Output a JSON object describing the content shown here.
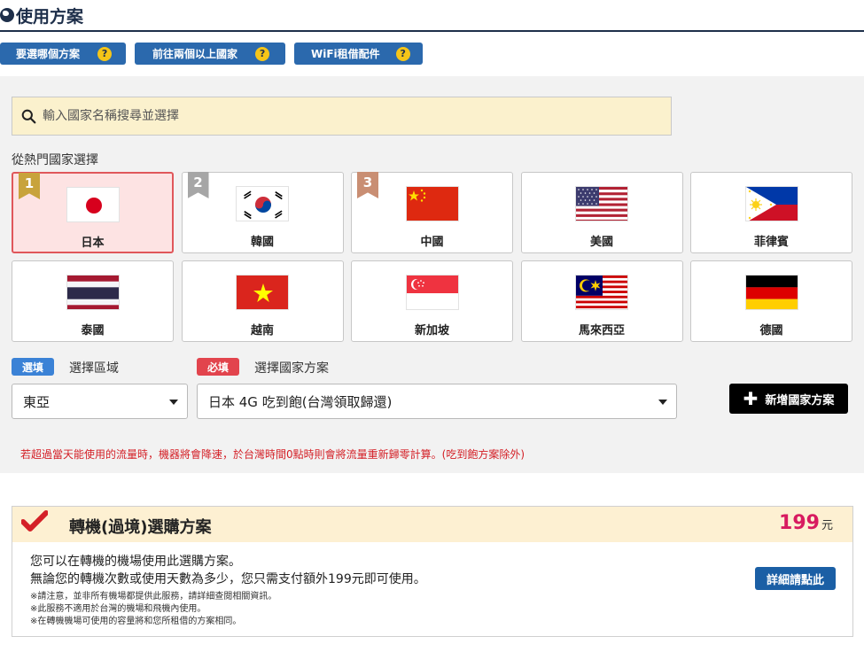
{
  "header": {
    "title": "使用方案"
  },
  "help_buttons": [
    {
      "label": "要選哪個方案",
      "icon": "?"
    },
    {
      "label": "前往兩個以上國家",
      "icon": "?"
    },
    {
      "label": "WiFi租借配件",
      "icon": "?"
    }
  ],
  "search": {
    "placeholder": "輸入國家名稱搜尋並選擇",
    "value": ""
  },
  "hot_countries": {
    "label": "從熱門國家選擇",
    "selected": "日本",
    "items": [
      {
        "name": "日本",
        "flag": "japan-flag",
        "rank": "1"
      },
      {
        "name": "韓國",
        "flag": "korea-flag",
        "rank": "2"
      },
      {
        "name": "中國",
        "flag": "china-flag",
        "rank": "3"
      },
      {
        "name": "美國",
        "flag": "usa-flag"
      },
      {
        "name": "菲律賓",
        "flag": "philippines-flag"
      },
      {
        "name": "泰國",
        "flag": "thailand-flag"
      },
      {
        "name": "越南",
        "flag": "vietnam-flag"
      },
      {
        "name": "新加坡",
        "flag": "singapore-flag"
      },
      {
        "name": "馬來西亞",
        "flag": "malaysia-flag"
      },
      {
        "name": "德國",
        "flag": "germany-flag"
      }
    ]
  },
  "region": {
    "tag": "選填",
    "label": "選擇區域",
    "value": "東亞"
  },
  "plan": {
    "tag": "必填",
    "label": "選擇國家方案",
    "value": "日本 4G 吃到飽(台灣領取歸還)"
  },
  "add_button": {
    "label": "新增國家方案"
  },
  "warning": "若超過當天能使用的流量時，機器將會降速，於台灣時間0點時則會將流量重新歸零計算。(吃到飽方案除外)",
  "transit": {
    "title": "轉機(過境)選購方案",
    "price": "199",
    "unit": "元",
    "desc1": "您可以在轉機的機場使用此選購方案。",
    "desc2": "無論您的轉機次數或使用天數為多少，您只需支付額外199元即可使用。",
    "notes": [
      "※請注意，並非所有機場都提供此服務，請詳細查閱相關資訊。",
      "※此服務不適用於台灣的機場和飛機內使用。",
      "※在轉機機場可使用的容量將和您所租借的方案相同。"
    ],
    "detail_button": "詳細請點此"
  },
  "colors": {
    "primary_blue": "#2b69ad",
    "selected_border": "#e0575b",
    "price_pink": "#d81b60",
    "warning_red": "#d42027"
  }
}
